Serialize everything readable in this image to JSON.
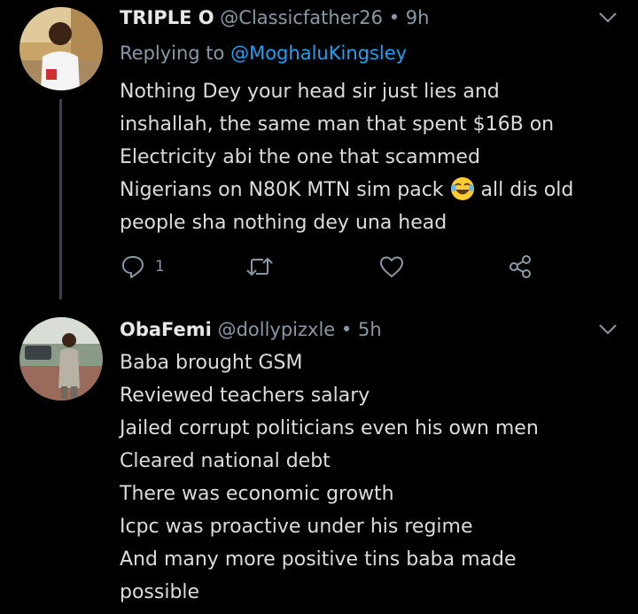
{
  "tweets": [
    {
      "display_name": "TRIPLE O",
      "handle": "@Classicfather26",
      "separator": "•",
      "time": "9h",
      "replying_prefix": "Replying to",
      "replying_to": "@MoghaluKingsley",
      "lines": [
        "Nothing Dey your head sir just lies and",
        "inshallah, the same man that spent $16B on",
        "Electricity abi the one that scammed",
        "Nigerians on N80K MTN sim pack",
        "all dis old",
        "people sha nothing dey una head"
      ],
      "emoji": "face-with-tears-of-joy-emoji",
      "reply_count": "1",
      "icons": [
        "reply-icon",
        "retweet-icon",
        "like-icon",
        "share-icon"
      ]
    },
    {
      "display_name": "ObaFemi",
      "handle": "@dollypizxle",
      "separator": "•",
      "time": "5h",
      "lines": [
        "Baba brought GSM",
        "Reviewed teachers salary",
        "Jailed corrupt politicians even his own men",
        "Cleared national debt",
        "There was economic growth",
        "Icpc was proactive under his regime",
        "And many more positive tins baba made",
        "possible"
      ]
    }
  ],
  "colors": {
    "background": "#000000",
    "text": "#dcdcdc",
    "secondary": "#8899a6",
    "link": "#1da1f2",
    "thread_line": "#38444d"
  }
}
